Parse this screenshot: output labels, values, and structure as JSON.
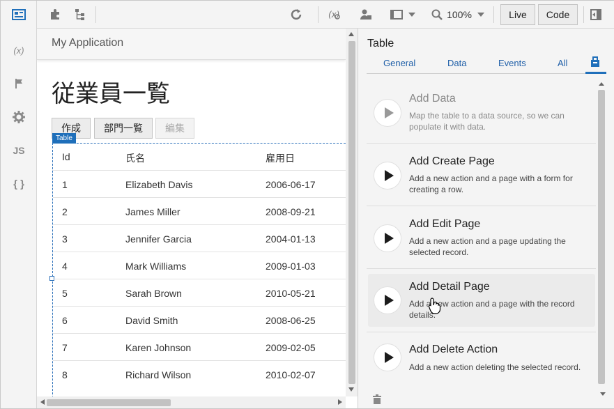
{
  "rail": {
    "items": [
      {
        "icon": "layout-icon"
      },
      {
        "icon": "variable-icon",
        "label": "(x)"
      },
      {
        "icon": "flag-icon"
      },
      {
        "icon": "gear-icon"
      },
      {
        "icon": "javascript-icon",
        "label": "JS"
      },
      {
        "icon": "braces-icon",
        "label": "{ }"
      }
    ]
  },
  "toolbar": {
    "zoom": "100%",
    "live_label": "Live",
    "code_label": "Code"
  },
  "canvas": {
    "app_title": "My Application",
    "page_title": "従業員一覧",
    "buttons": {
      "create": "作成",
      "departments": "部門一覧",
      "edit": "編集"
    },
    "table_tag": "Table",
    "table": {
      "columns": [
        "Id",
        "氏名",
        "雇用日"
      ],
      "rows": [
        [
          "1",
          "Elizabeth Davis",
          "2006-06-17"
        ],
        [
          "2",
          "James Miller",
          "2008-09-21"
        ],
        [
          "3",
          "Jennifer Garcia",
          "2004-01-13"
        ],
        [
          "4",
          "Mark Williams",
          "2009-01-03"
        ],
        [
          "5",
          "Sarah Brown",
          "2010-05-21"
        ],
        [
          "6",
          "David Smith",
          "2008-06-25"
        ],
        [
          "7",
          "Karen Johnson",
          "2009-02-05"
        ],
        [
          "8",
          "Richard Wilson",
          "2010-02-07"
        ]
      ]
    }
  },
  "panel": {
    "title": "Table",
    "tabs": [
      "General",
      "Data",
      "Events",
      "All"
    ],
    "actions": [
      {
        "title": "Add Data",
        "desc": "Map the table to a data source, so we can populate it with data."
      },
      {
        "title": "Add Create Page",
        "desc": "Add a new action and a page with a form for creating a row."
      },
      {
        "title": "Add Edit Page",
        "desc": "Add a new action and a page updating the selected record."
      },
      {
        "title": "Add Detail Page",
        "desc": "Add a new action and a page with the record details."
      },
      {
        "title": "Add Delete Action",
        "desc": "Add a new action deleting the selected record."
      }
    ]
  },
  "colors": {
    "accent": "#1f6fba",
    "link": "#1f5fa8"
  }
}
